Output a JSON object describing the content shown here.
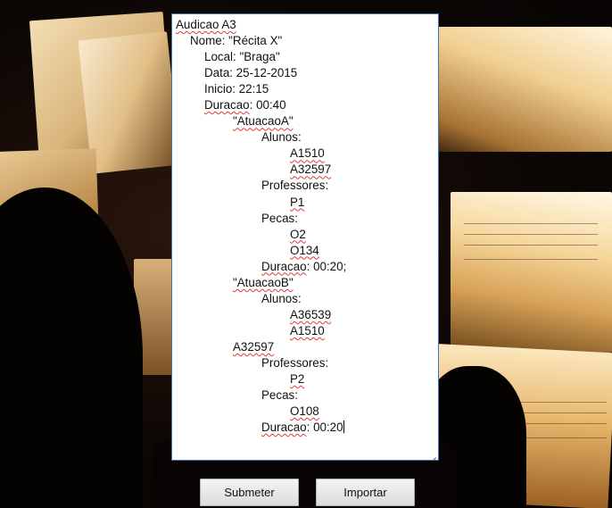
{
  "editor": {
    "lines": [
      {
        "indent": 0,
        "parts": [
          {
            "t": "Audicao A3",
            "sq": true
          }
        ]
      },
      {
        "indent": 1,
        "parts": [
          {
            "t": "Nome: \"Récita X\"",
            "sq": false
          }
        ]
      },
      {
        "indent": 2,
        "parts": [
          {
            "t": "Local: \"Braga\"",
            "sq": false
          }
        ]
      },
      {
        "indent": 2,
        "parts": [
          {
            "t": "Data: 25-12-2015",
            "sq": false
          }
        ]
      },
      {
        "indent": 2,
        "parts": [
          {
            "t": "Inicio: 22:15",
            "sq": false
          }
        ]
      },
      {
        "indent": 2,
        "parts": [
          {
            "t": "Duracao",
            "sq": true
          },
          {
            "t": ": 00:40",
            "sq": false
          }
        ]
      },
      {
        "indent": 4,
        "parts": [
          {
            "t": "\"AtuacaoA\"",
            "sq": true
          }
        ]
      },
      {
        "indent": 6,
        "parts": [
          {
            "t": "Alunos:",
            "sq": false
          }
        ]
      },
      {
        "indent": 8,
        "parts": [
          {
            "t": "A1510",
            "sq": true
          }
        ]
      },
      {
        "indent": 8,
        "parts": [
          {
            "t": "A32597",
            "sq": true
          }
        ]
      },
      {
        "indent": 6,
        "parts": [
          {
            "t": "Professores:",
            "sq": false
          }
        ]
      },
      {
        "indent": 8,
        "parts": [
          {
            "t": "P1",
            "sq": true
          }
        ]
      },
      {
        "indent": 6,
        "parts": [
          {
            "t": "Pecas",
            "sq": false
          },
          {
            "t": ":",
            "sq": false
          }
        ]
      },
      {
        "indent": 8,
        "parts": [
          {
            "t": "O2",
            "sq": true
          }
        ]
      },
      {
        "indent": 8,
        "parts": [
          {
            "t": "O134",
            "sq": true
          }
        ]
      },
      {
        "indent": 6,
        "parts": [
          {
            "t": "Duracao",
            "sq": true
          },
          {
            "t": ": 00:20;",
            "sq": false
          }
        ]
      },
      {
        "indent": 4,
        "parts": [
          {
            "t": "\"AtuacaoB\"",
            "sq": true
          }
        ]
      },
      {
        "indent": 6,
        "parts": [
          {
            "t": "Alunos:",
            "sq": false
          }
        ]
      },
      {
        "indent": 8,
        "parts": [
          {
            "t": "A36539",
            "sq": true
          }
        ]
      },
      {
        "indent": 8,
        "parts": [
          {
            "t": "A1510",
            "sq": true
          }
        ]
      },
      {
        "indent": 4,
        "parts": [
          {
            "t": "A32597",
            "sq": true
          }
        ]
      },
      {
        "indent": 6,
        "parts": [
          {
            "t": "Professores:",
            "sq": false
          }
        ]
      },
      {
        "indent": 8,
        "parts": [
          {
            "t": "P2",
            "sq": true
          }
        ]
      },
      {
        "indent": 6,
        "parts": [
          {
            "t": "Pecas:",
            "sq": false
          }
        ]
      },
      {
        "indent": 8,
        "parts": [
          {
            "t": "O108",
            "sq": true
          }
        ]
      },
      {
        "indent": 6,
        "parts": [
          {
            "t": "Duracao",
            "sq": true
          },
          {
            "t": ": 00:20",
            "sq": false
          }
        ],
        "caret": true
      }
    ]
  },
  "buttons": {
    "submit_label": "Submeter",
    "import_label": "Importar"
  },
  "icons": {
    "resize_grip": "resize-grip-icon"
  }
}
